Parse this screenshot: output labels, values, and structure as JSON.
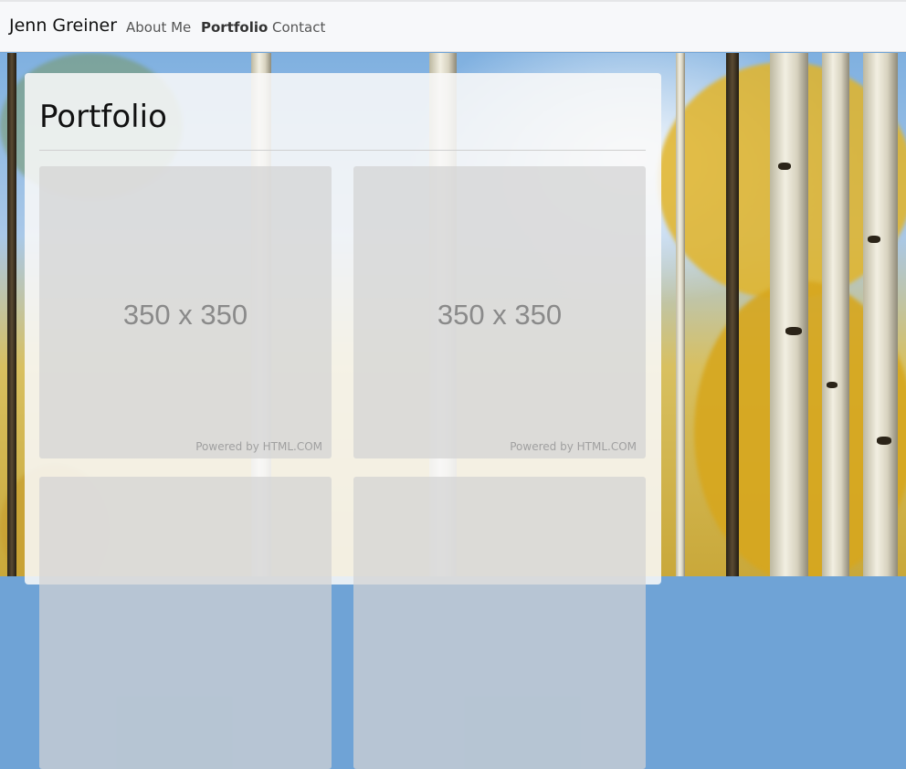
{
  "navbar": {
    "brand": "Jenn Greiner",
    "links": [
      {
        "label": "About Me",
        "active": false
      },
      {
        "label": "Portfolio",
        "active": true
      },
      {
        "label": "Contact",
        "active": false
      }
    ]
  },
  "main": {
    "title": "Portfolio",
    "tiles": [
      {
        "dimensions": "350 x 350",
        "credit": "Powered by HTML.COM"
      },
      {
        "dimensions": "350 x 350",
        "credit": "Powered by HTML.COM"
      },
      {
        "dimensions": "",
        "credit": ""
      },
      {
        "dimensions": "",
        "credit": ""
      }
    ]
  },
  "colors": {
    "navbar_bg": "#f7f8fa",
    "panel_bg": "#f8f8f8",
    "placeholder_bg": "#d2d2d2",
    "foliage": "#e0b42a"
  }
}
